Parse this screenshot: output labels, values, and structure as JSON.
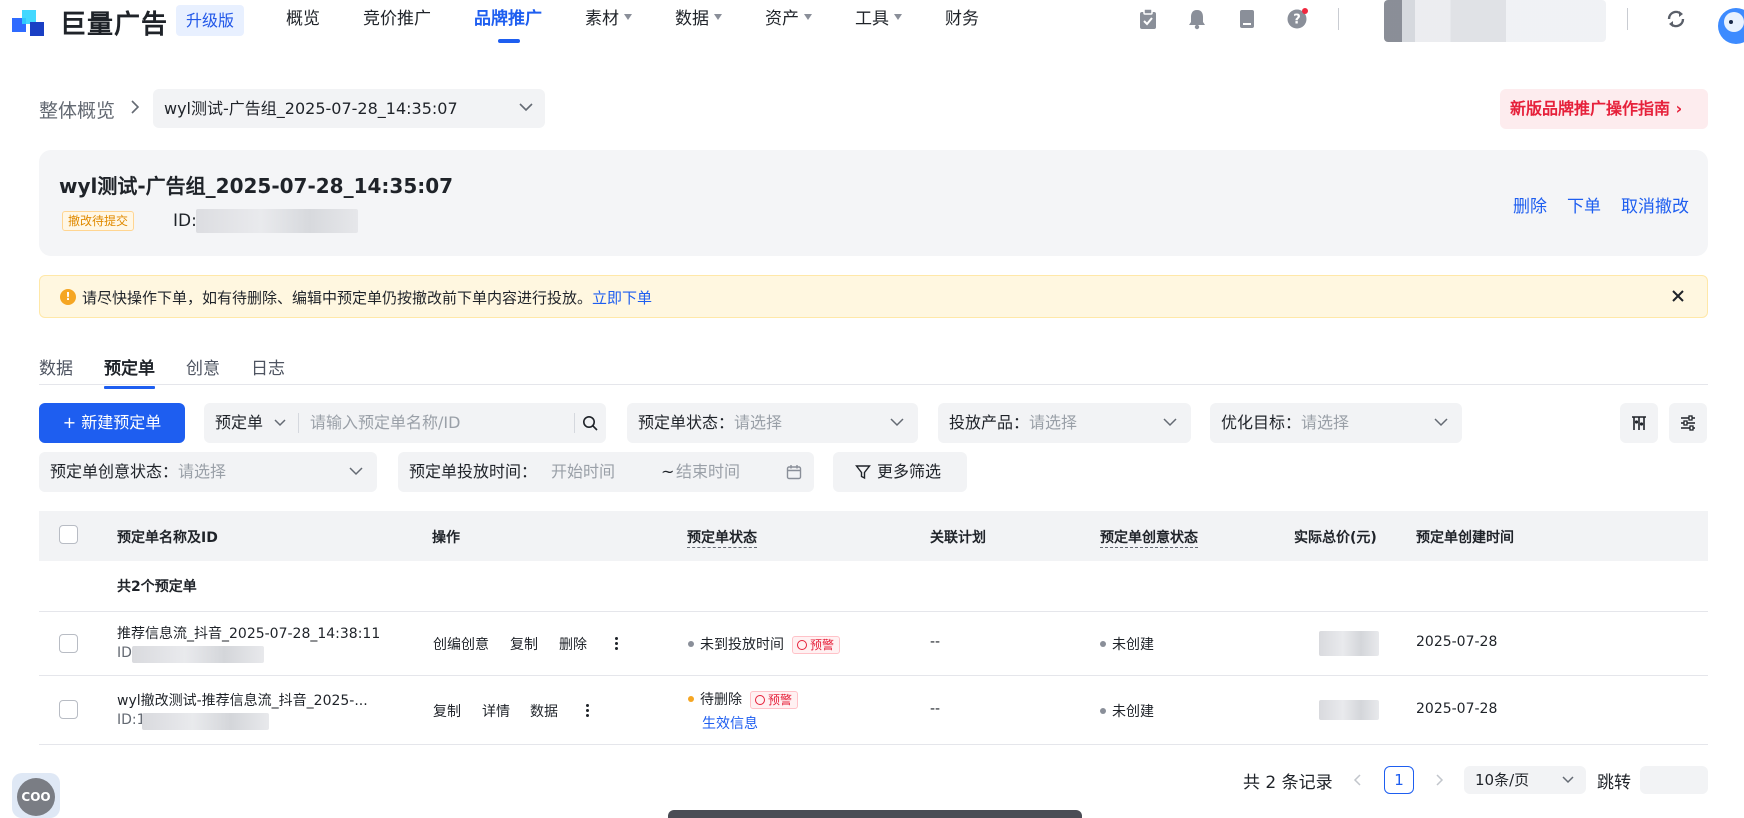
{
  "brand": {
    "name": "巨量广告",
    "edition_badge": "升级版"
  },
  "nav": {
    "items": [
      {
        "label": "概览",
        "has_caret": false,
        "active": false
      },
      {
        "label": "竞价推广",
        "has_caret": false,
        "active": false
      },
      {
        "label": "品牌推广",
        "has_caret": false,
        "active": true
      },
      {
        "label": "素材",
        "has_caret": true,
        "active": false
      },
      {
        "label": "数据",
        "has_caret": true,
        "active": false
      },
      {
        "label": "资产",
        "has_caret": true,
        "active": false
      },
      {
        "label": "工具",
        "has_caret": true,
        "active": false
      },
      {
        "label": "财务",
        "has_caret": false,
        "active": false
      }
    ],
    "icons": [
      "clipboard-check-icon",
      "bell-icon",
      "document-icon",
      "help-icon",
      "refresh-icon"
    ]
  },
  "breadcrumb": {
    "root": "整体概览",
    "current_group": "wyl测试-广告组_2025-07-28_14:35:07"
  },
  "guide_button": {
    "label": "新版品牌推广操作指南 ›"
  },
  "group_card": {
    "title": "wyl测试-广告组_2025-07-28_14:35:07",
    "status_tag": "撤改待提交",
    "id_label": "ID:",
    "actions": [
      "删除",
      "下单",
      "取消撤改"
    ]
  },
  "alert": {
    "message": "请尽快操作下单，如有待删除、编辑中预定单仍按撤改前下单内容进行投放。",
    "link": "立即下单"
  },
  "tabs": [
    {
      "label": "数据",
      "active": false
    },
    {
      "label": "预定单",
      "active": true
    },
    {
      "label": "创意",
      "active": false
    },
    {
      "label": "日志",
      "active": false
    }
  ],
  "filters": {
    "new_button": "+ 新建预定单",
    "search_type": "预定单",
    "search_placeholder": "请输入预定单名称/ID",
    "status_label": "预定单状态：",
    "status_placeholder": "请选择",
    "product_label": "投放产品：",
    "product_placeholder": "请选择",
    "target_label": "优化目标：",
    "target_placeholder": "请选择",
    "creative_status_label": "预定单创意状态：",
    "creative_status_placeholder": "请选择",
    "time_label": "预定单投放时间：",
    "start_placeholder": "开始时间",
    "time_sep": "~",
    "end_placeholder": "结束时间",
    "more_filters": "更多筛选"
  },
  "table": {
    "columns": [
      "预定单名称及ID",
      "操作",
      "预定单状态",
      "关联计划",
      "预定单创意状态",
      "实际总价(元)",
      "预定单创建时间"
    ],
    "summary": "共2个预定单",
    "rows": [
      {
        "name": "推荐信息流_抖音_2025-07-28_14:38:11",
        "id_prefix": "ID:",
        "actions": [
          "创编创意",
          "复制",
          "删除"
        ],
        "status": "未到投放时间",
        "status_color": "#8a8f99",
        "warning": "预警",
        "plan": "--",
        "creative_status": "未创建",
        "created": "2025-07-28"
      },
      {
        "name": "wyl撤改测试-推荐信息流_抖音_2025-...",
        "id_prefix": "ID:1",
        "actions": [
          "复制",
          "详情",
          "数据"
        ],
        "status": "待删除",
        "status_color": "#f5a623",
        "warning": "预警",
        "status_link": "生效信息",
        "plan": "--",
        "creative_status": "未创建",
        "created": "2025-07-28"
      }
    ]
  },
  "pagination": {
    "total_text": "共 2 条记录",
    "current_page": "1",
    "page_size": "10条/页",
    "jump_label": "跳转"
  },
  "colors": {
    "primary": "#1e5ef0",
    "danger": "#e6213b",
    "warning": "#f5a623"
  }
}
